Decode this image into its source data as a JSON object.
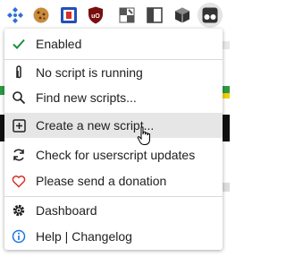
{
  "toolbar": {
    "icons": [
      "puzzle-piece-icon",
      "cookie-icon",
      "blue-shield-extension-icon",
      "ublock-origin-icon",
      "chess-board-icon",
      "split-panel-icon",
      "cube-icon",
      "tampermonkey-icon"
    ],
    "active_icon": "tampermonkey-icon"
  },
  "menu": {
    "hovered_item": "create_new",
    "items": {
      "enabled": {
        "label": "Enabled",
        "icon": "checkmark-icon",
        "icon_color": "#1e8e3e"
      },
      "no_script": {
        "label": "No script is running",
        "icon": "paper-clip-icon"
      },
      "find": {
        "label": "Find new scripts...",
        "icon": "search-icon"
      },
      "create_new": {
        "label": "Create a new script...",
        "icon": "plus-square-icon"
      },
      "check_updates": {
        "label": "Check for userscript updates",
        "icon": "refresh-icon"
      },
      "donate": {
        "label": "Please send a donation",
        "icon": "heart-icon",
        "icon_color": "#d93025"
      },
      "dashboard": {
        "label": "Dashboard",
        "icon": "gear-icon"
      },
      "help": {
        "label": "Help | Changelog",
        "icon": "info-icon",
        "icon_color": "#1a73e8"
      }
    }
  },
  "colors": {
    "hover_bg": "#e6e6e6",
    "toolbar_active_bg": "#e3e3e3",
    "page_green": "#2e9a46"
  }
}
